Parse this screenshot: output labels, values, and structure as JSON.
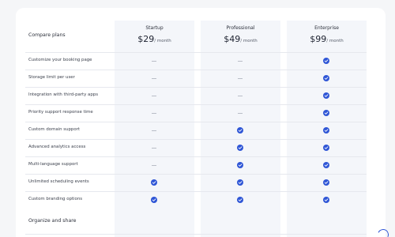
{
  "comparison": {
    "title": "Compare plans",
    "plans": [
      {
        "name": "Startup",
        "price": "$29",
        "period": "/ month"
      },
      {
        "name": "Professional",
        "price": "$49",
        "period": "/ month"
      },
      {
        "name": "Enterprise",
        "price": "$99",
        "period": "/ month"
      }
    ],
    "features": [
      {
        "label": "Customize your booking page",
        "startup": false,
        "professional": false,
        "enterprise": true
      },
      {
        "label": "Storage limit per user",
        "startup": false,
        "professional": false,
        "enterprise": true
      },
      {
        "label": "Integration with third-party apps",
        "startup": false,
        "professional": false,
        "enterprise": true
      },
      {
        "label": "Priority support response time",
        "startup": false,
        "professional": false,
        "enterprise": true
      },
      {
        "label": "Custom domain support",
        "startup": false,
        "professional": true,
        "enterprise": true
      },
      {
        "label": "Advanced analytics access",
        "startup": false,
        "professional": true,
        "enterprise": true
      },
      {
        "label": "Multi-language support",
        "startup": false,
        "professional": true,
        "enterprise": true
      },
      {
        "label": "Unlimited scheduling events",
        "startup": true,
        "professional": true,
        "enterprise": true
      },
      {
        "label": "Custom branding options",
        "startup": true,
        "professional": true,
        "enterprise": true
      }
    ],
    "next_section_title": "Organize and share"
  },
  "icons": {
    "included": "check-circle-icon",
    "not_included": "dash-icon",
    "loading": "loading-spinner-icon"
  },
  "colors": {
    "accent": "#2f56d6",
    "dash": "#b9bdc7",
    "column_bg": "#f4f6fa"
  }
}
